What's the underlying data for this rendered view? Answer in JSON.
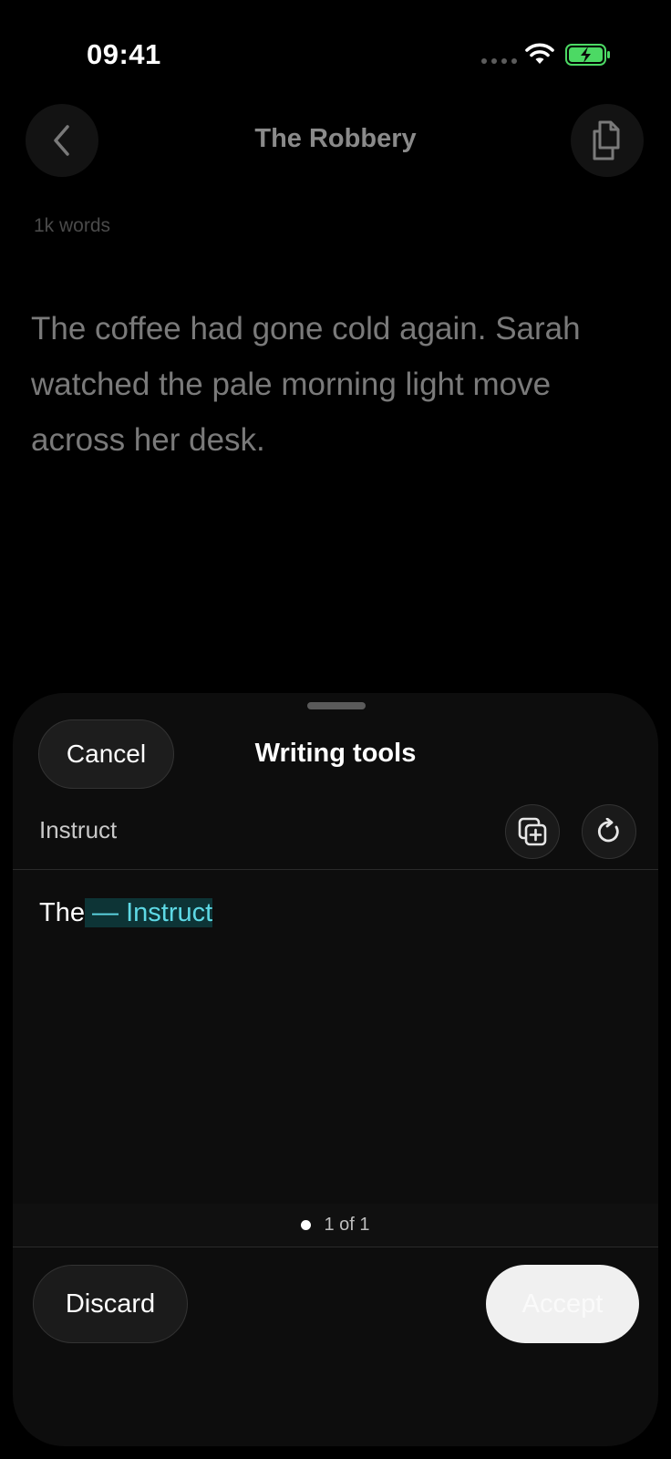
{
  "status_bar": {
    "time": "09:41"
  },
  "header": {
    "title": "The Robbery",
    "back_icon": "chevron-left-icon",
    "copy_icon": "copy-document-icon"
  },
  "document": {
    "word_count": "1k words",
    "text": "The coffee had gone cold again. Sarah watched the pale morning light move across her desk."
  },
  "sheet": {
    "cancel_label": "Cancel",
    "title": "Writing tools",
    "instruct_label": "Instruct",
    "add_icon": "add-square-icon",
    "refresh_icon": "refresh-icon",
    "result_plain": "The",
    "result_highlight": " — Instruct",
    "pager_text": "1 of 1",
    "discard_label": "Discard",
    "accept_label": "Accept"
  },
  "colors": {
    "background": "#000000",
    "sheet": "#0d0d0d",
    "highlight_text": "#5ed9e5",
    "highlight_bg": "#0d3436",
    "battery_green": "#4cd964"
  }
}
